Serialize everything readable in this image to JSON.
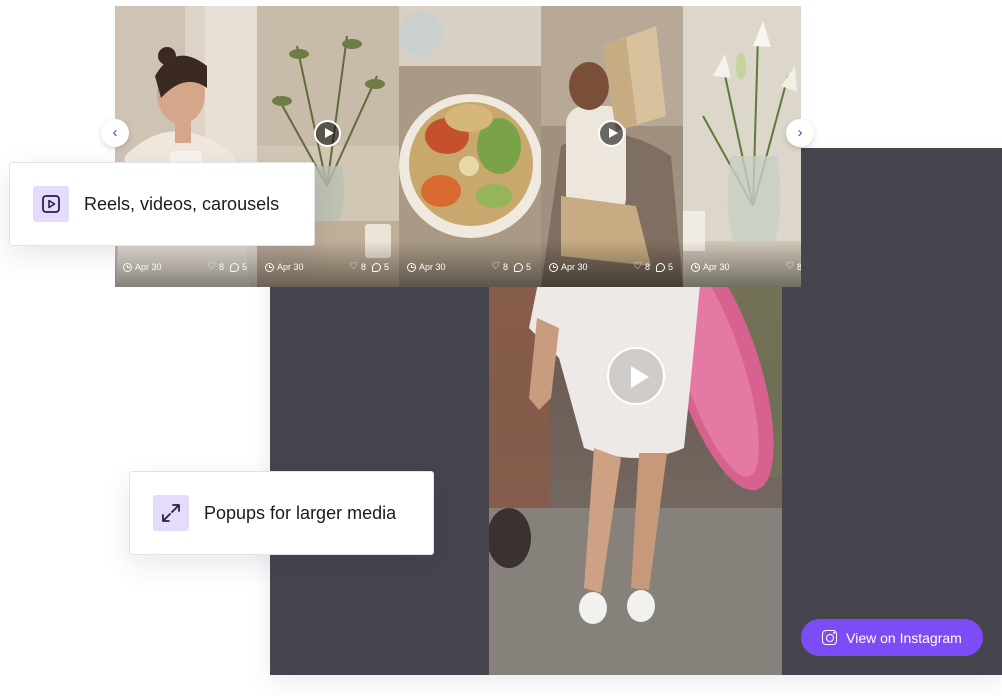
{
  "carousel": {
    "prev_icon": "chevron-left-icon",
    "next_icon": "chevron-right-icon",
    "posts": [
      {
        "date": "Apr 30",
        "likes": "8",
        "comments": "5",
        "video": false
      },
      {
        "date": "Apr 30",
        "likes": "8",
        "comments": "5",
        "video": true
      },
      {
        "date": "Apr 30",
        "likes": "8",
        "comments": "5",
        "video": false
      },
      {
        "date": "Apr 30",
        "likes": "8",
        "comments": "5",
        "video": true
      },
      {
        "date": "Apr 30",
        "likes": "8",
        "comments": "",
        "video": false
      }
    ]
  },
  "features": {
    "reels_label": "Reels, videos, carousels",
    "popups_label": "Popups for larger media"
  },
  "popup": {
    "view_button": "View on Instagram",
    "view_icon": "instagram-icon"
  },
  "colors": {
    "accent": "#7c4df6",
    "feature_icon_bg": "#e5dcfb",
    "popup_backdrop": "#46444c"
  }
}
